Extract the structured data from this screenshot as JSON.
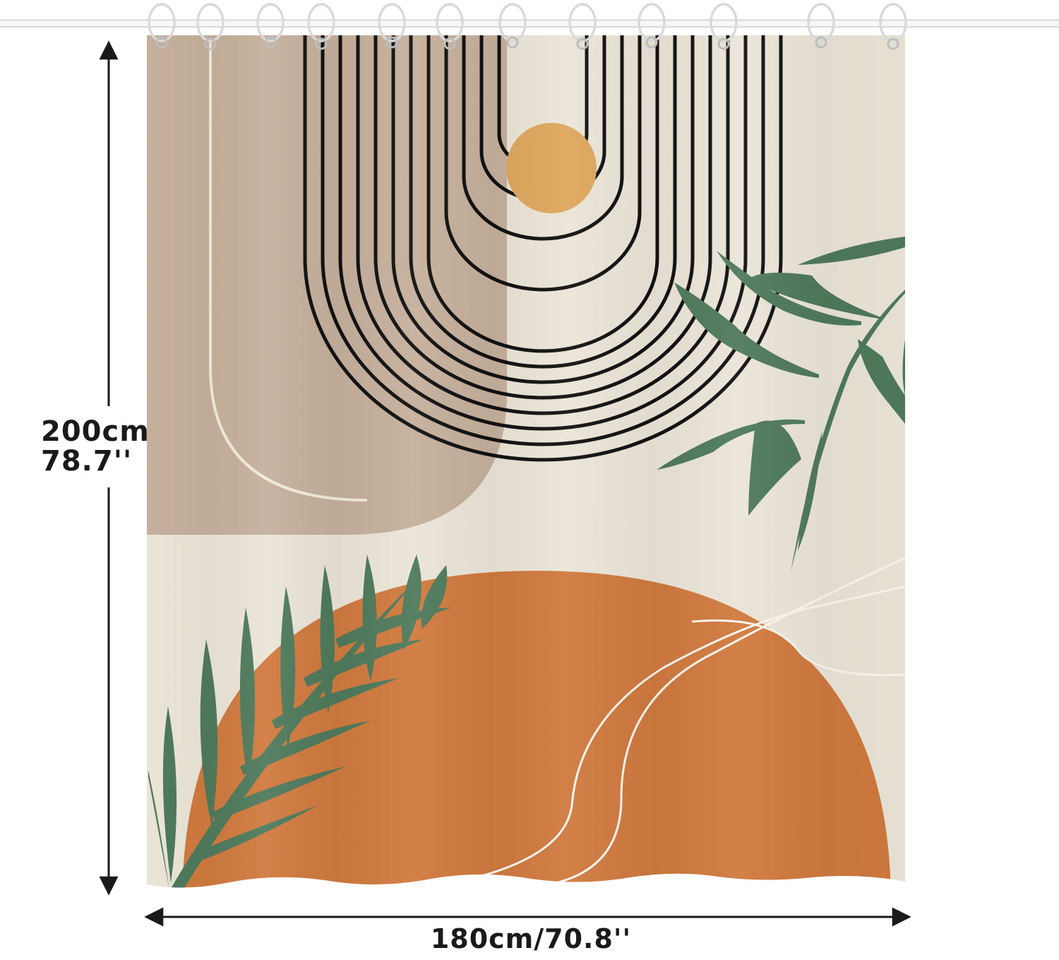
{
  "dimensions": {
    "height_cm": "200cm",
    "height_in": "78.7''",
    "width": "180cm/70.8''"
  },
  "product": {
    "hook_count": 12,
    "colors": {
      "background": "#ebe5d8",
      "beige_arch": "#c9b3a0",
      "sun_yellow": "#dea75d",
      "orange_sun": "#d07a3f",
      "leaf_green": "#4f7a5c",
      "line_black": "#111111",
      "rod_white": "#f4f4f4"
    }
  }
}
